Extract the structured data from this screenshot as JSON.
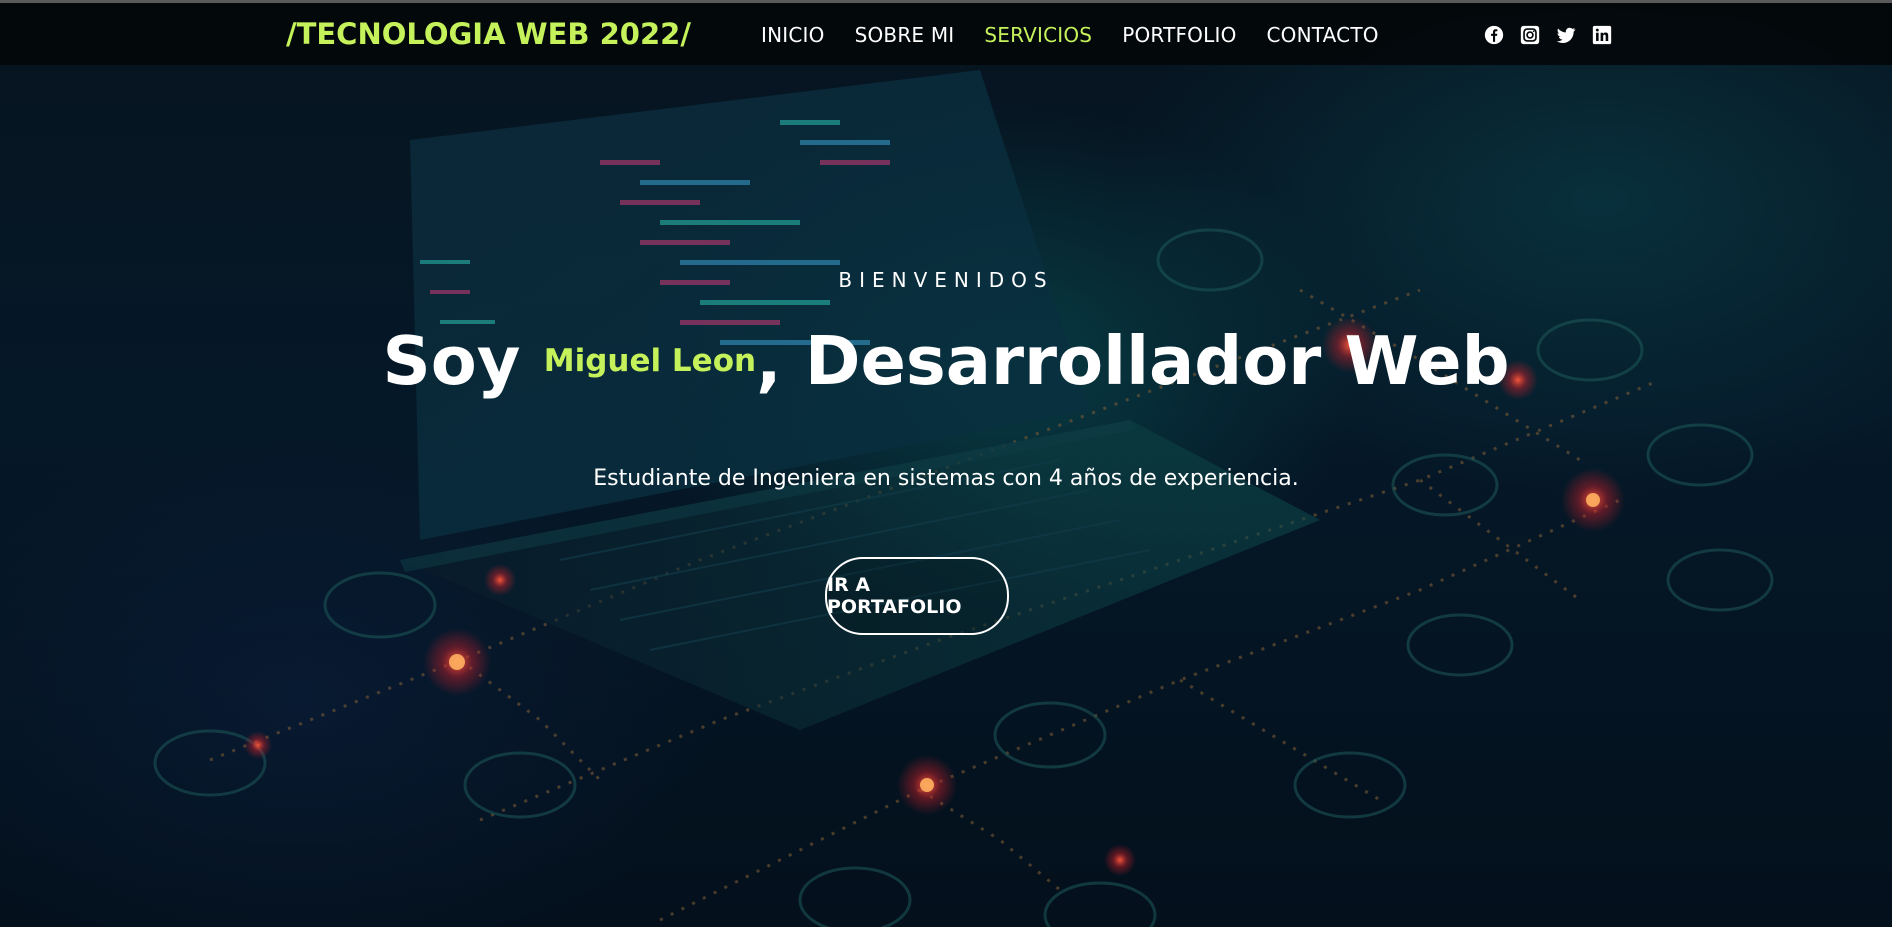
{
  "header": {
    "brand": "/TECNOLOGIA WEB 2022/",
    "nav": [
      {
        "label": "INICIO",
        "active": false
      },
      {
        "label": "SOBRE MI",
        "active": false
      },
      {
        "label": "SERVICIOS",
        "active": true
      },
      {
        "label": "PORTFOLIO",
        "active": false
      },
      {
        "label": "CONTACTO",
        "active": false
      }
    ],
    "social": [
      "facebook-icon",
      "instagram-icon",
      "twitter-icon",
      "linkedin-icon"
    ]
  },
  "hero": {
    "kicker": "BIENVENIDOS",
    "title_prefix": "Soy ",
    "title_name": "Miguel Leon",
    "title_suffix": ", Desarrollador Web",
    "subtitle": "Estudiante de Ingeniera en sistemas con 4 años de experiencia.",
    "cta_label": "IR A PORTAFOLIO"
  },
  "colors": {
    "accent": "#c5f25a",
    "navbar_bg": "#03080a",
    "text": "#ffffff"
  }
}
